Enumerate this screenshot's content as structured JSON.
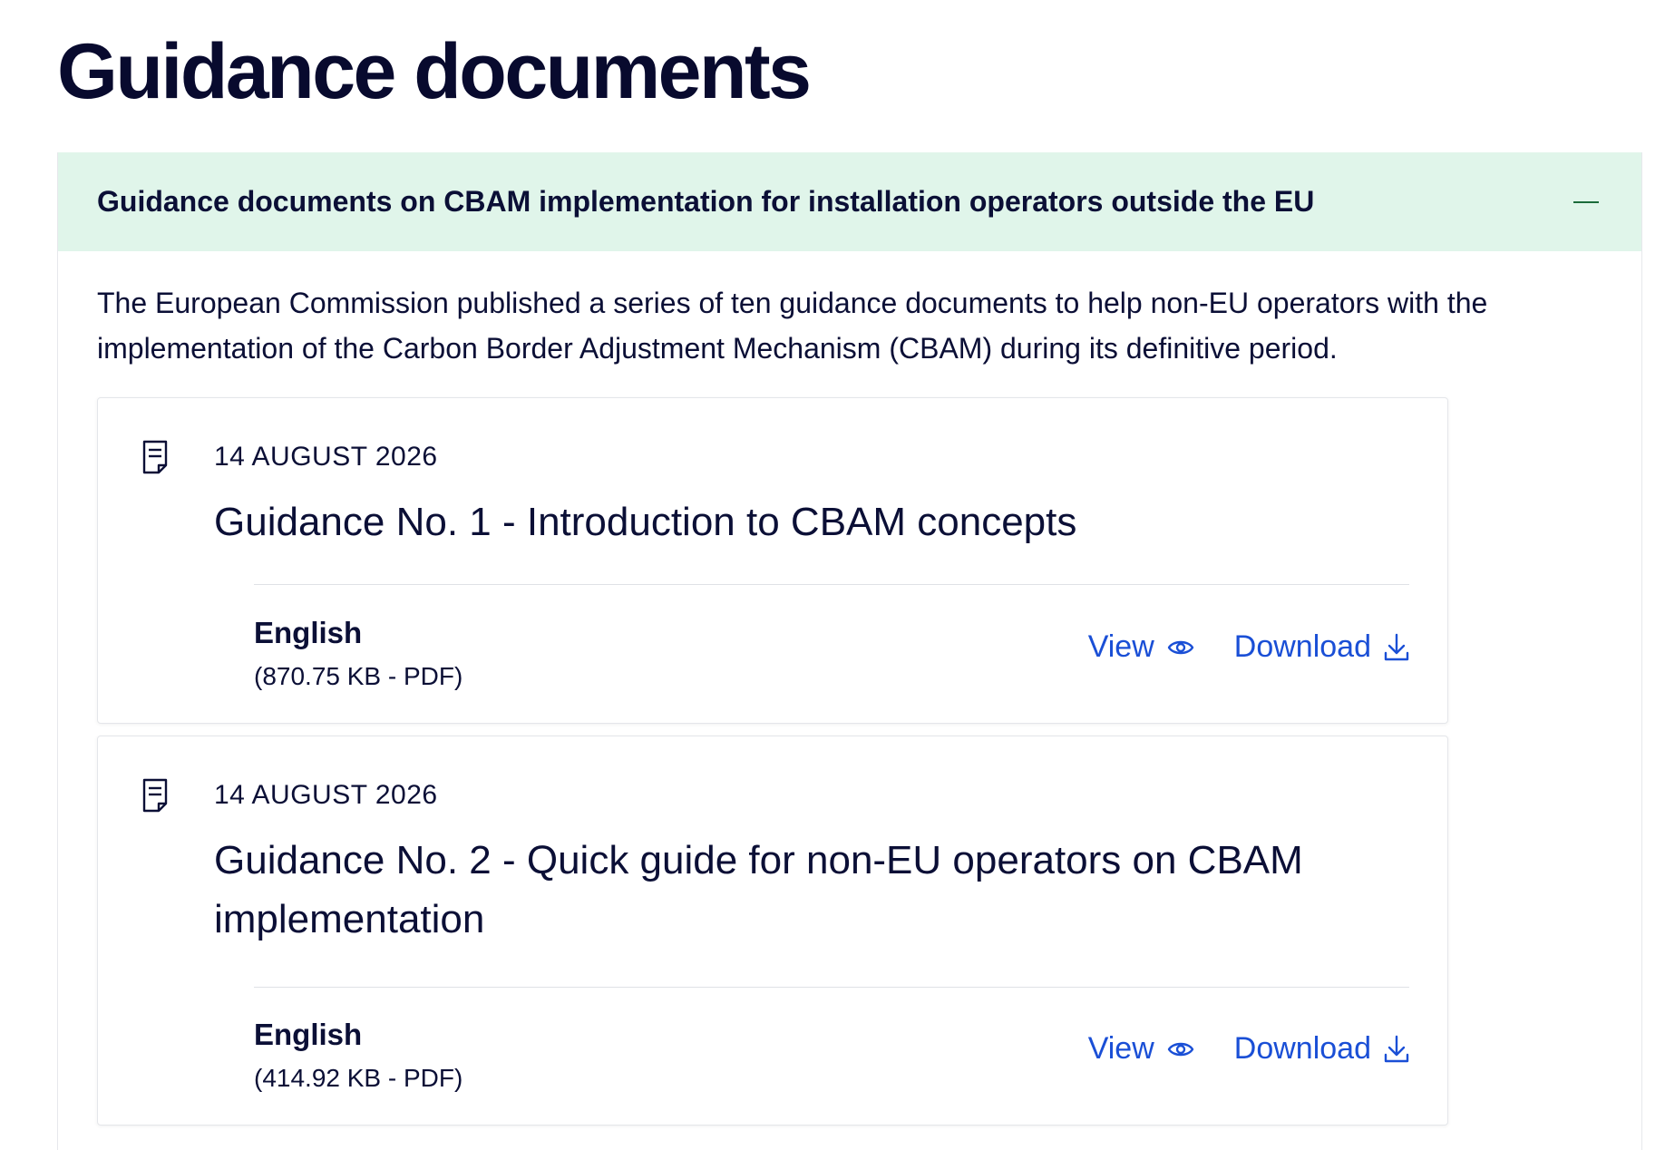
{
  "page": {
    "title": "Guidance documents"
  },
  "accordion": {
    "title": "Guidance documents on CBAM implementation for installation operators outside the EU",
    "toggle_icon": "minus-icon",
    "intro": "The European Commission published a series of ten guidance documents to help non-EU operators with the implementation of the Carbon Border Adjustment Mechanism (CBAM) during its definitive period."
  },
  "documents": [
    {
      "icon": "document-icon",
      "date": "14 AUGUST 2026",
      "title": "Guidance No. 1 - Introduction to CBAM concepts",
      "language": "English",
      "meta": "(870.75 KB - PDF)",
      "view_label": "View",
      "download_label": "Download"
    },
    {
      "icon": "document-icon",
      "date": "14 AUGUST 2026",
      "title": "Guidance No. 2 - Quick guide for non-EU operators on CBAM implementation",
      "language": "English",
      "meta": "(414.92 KB - PDF)",
      "view_label": "View",
      "download_label": "Download"
    }
  ],
  "colors": {
    "accordion_header_bg": "#e0f5ea",
    "link": "#1a4fd6",
    "text": "#0b0f36"
  }
}
